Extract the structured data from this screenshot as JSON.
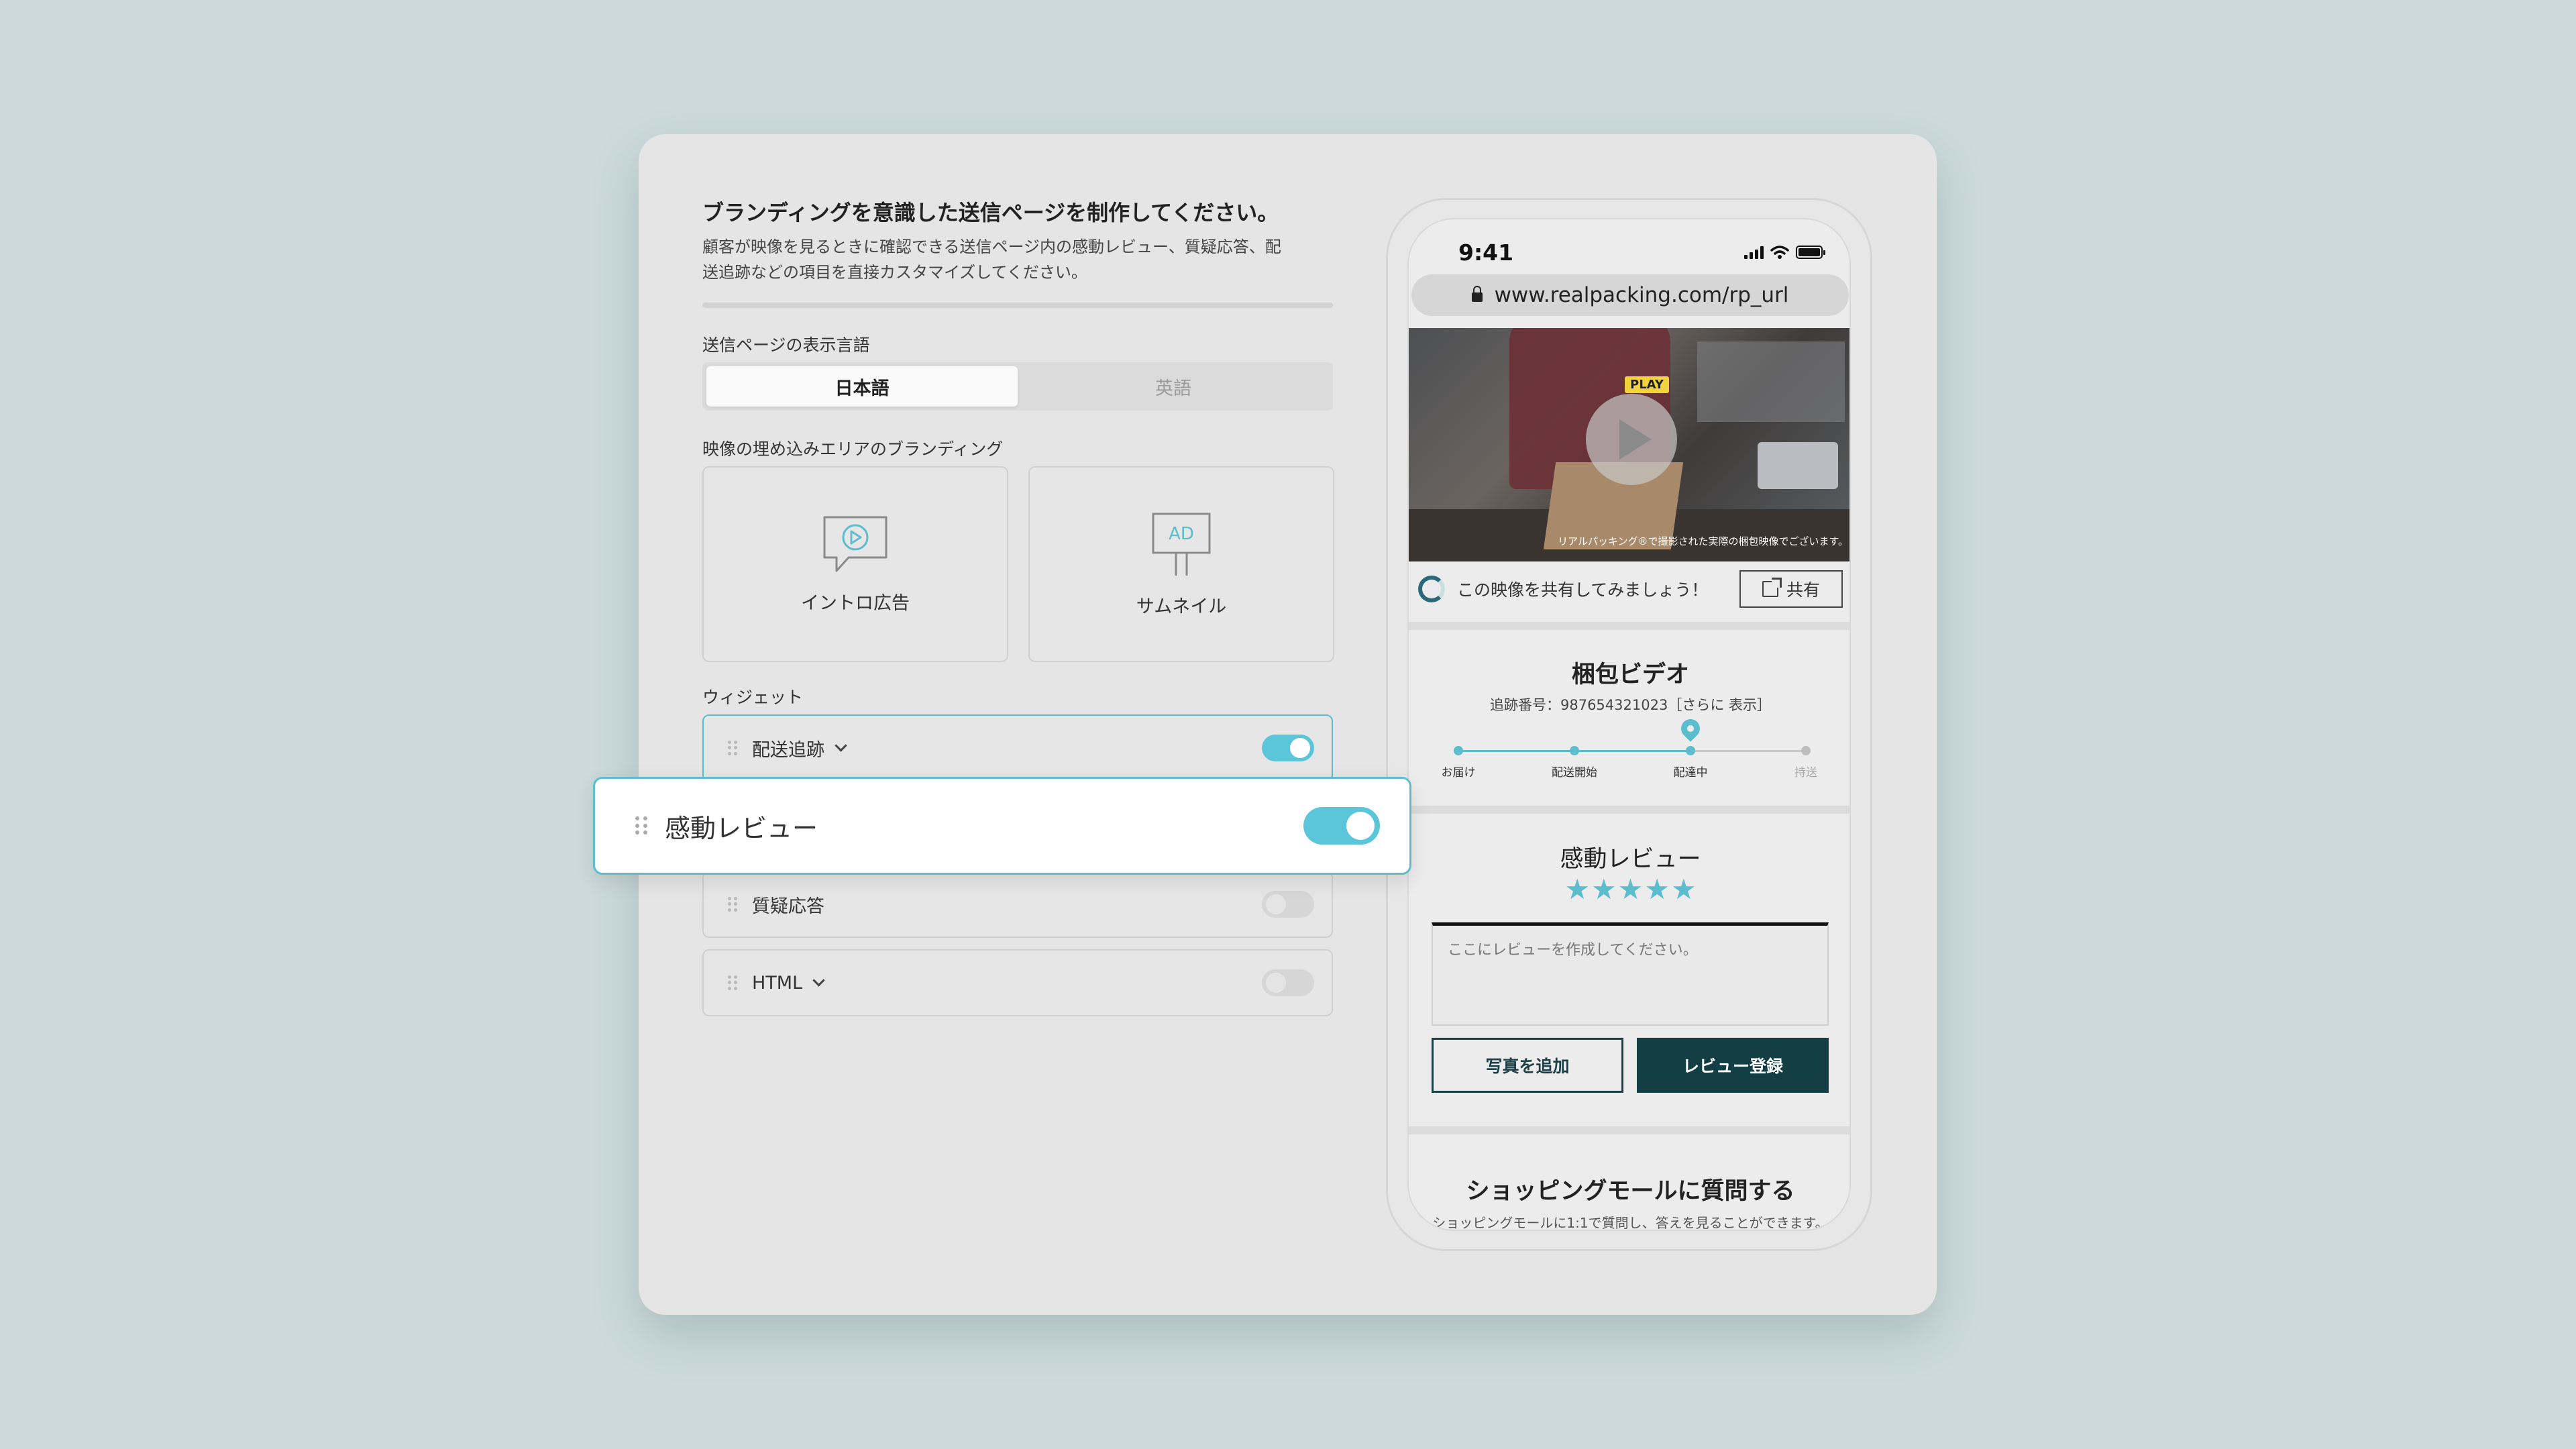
{
  "panel": {
    "title": "ブランディングを意識した送信ページを制作してください。",
    "description": "顧客が映像を見るときに確認できる送信ページ内の感動レビュー、質疑応答、配送追跡などの項目を直接カスタマイズしてください。",
    "language_label": "送信ページの表示言語",
    "languages": [
      {
        "label": "日本語",
        "selected": true
      },
      {
        "label": "英語",
        "selected": false
      }
    ],
    "branding_label": "映像の埋め込みエリアのブランディング",
    "branding_tiles": [
      {
        "label": "イントロ広告",
        "icon": "video-speech-bubble-icon"
      },
      {
        "label": "サムネイル",
        "icon": "ad-sign-icon",
        "icon_text": "AD"
      }
    ],
    "widget_label": "ウィジェット",
    "widgets": [
      {
        "label": "配送追跡",
        "enabled": true,
        "expandable": true
      },
      {
        "label": "感動レビュー",
        "enabled": true,
        "expandable": false
      },
      {
        "label": "質疑応答",
        "enabled": false,
        "expandable": false
      },
      {
        "label": "HTML",
        "enabled": false,
        "expandable": true
      }
    ]
  },
  "phone": {
    "status_time": "9:41",
    "url": "www.realpacking.com/rp_url",
    "video": {
      "play_tag": "PLAY",
      "caption": "リアルパッキング®で撮影された実際の梱包映像でございます。"
    },
    "share": {
      "prompt": "この映像を共有してみましょう！",
      "button": "共有"
    },
    "packing_video": {
      "title": "梱包ビデオ",
      "tracking_text": "追跡番号：987654321023［さらに 表示］",
      "steps": [
        {
          "label": "お届け",
          "done": true
        },
        {
          "label": "配送開始",
          "done": true
        },
        {
          "label": "配達中",
          "done": true,
          "current": true
        },
        {
          "label": "持送",
          "done": false
        }
      ]
    },
    "review": {
      "title": "感動レビュー",
      "rating": 5,
      "max_rating": 5,
      "placeholder": "ここにレビューを作成してください。",
      "add_photo_button": "写真を追加",
      "submit_button": "レビュー登録"
    },
    "mall": {
      "title": "ショッピングモールに質問する",
      "subtitle": "ショッピングモールに1:1で質問し、答えを見ることができます。"
    }
  },
  "colors": {
    "background": "#ccdadb",
    "accent": "#5bc6d9",
    "dark_button": "#123e44"
  }
}
